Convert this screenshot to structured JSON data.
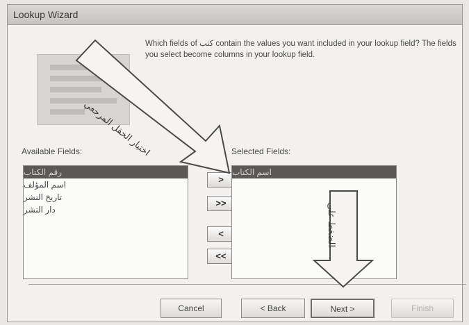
{
  "window": {
    "title": "Lookup Wizard"
  },
  "prompt": "Which fields of كتب contain the values you want included in your lookup field? The fields you select become columns in your lookup field.",
  "available": {
    "label": "Available Fields:",
    "items": [
      "رقم الكتاب",
      "اسم المؤلف",
      "تاريخ النشر",
      "دار النشر"
    ],
    "selected_index": 0
  },
  "selected": {
    "label": "Selected Fields:",
    "items": [
      "اسم الكتاب"
    ],
    "selected_index": 0
  },
  "move_buttons": {
    "add_one": ">",
    "add_all": ">>",
    "remove_one": "<",
    "remove_all": "<<"
  },
  "buttons": {
    "cancel": "Cancel",
    "back": "< Back",
    "next": "Next >",
    "finish": "Finish"
  },
  "annotations": {
    "arrow_diagonal": "اختيار الحقل المرجعي",
    "arrow_vertical": "الضغط على"
  }
}
